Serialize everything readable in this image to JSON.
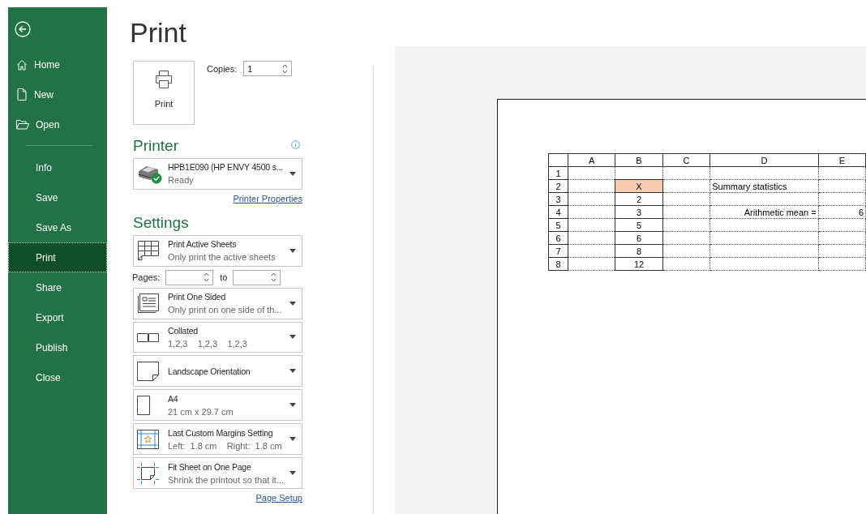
{
  "sidebar": {
    "items": [
      {
        "label": "Home",
        "kind": "home",
        "selected": false
      },
      {
        "label": "New",
        "kind": "new",
        "selected": false
      },
      {
        "label": "Open",
        "kind": "open",
        "selected": false
      },
      {
        "label": "Info",
        "kind": "text",
        "selected": false
      },
      {
        "label": "Save",
        "kind": "text",
        "selected": false
      },
      {
        "label": "Save As",
        "kind": "text",
        "selected": false
      },
      {
        "label": "Print",
        "kind": "text",
        "selected": true
      },
      {
        "label": "Share",
        "kind": "text",
        "selected": false
      },
      {
        "label": "Export",
        "kind": "text",
        "selected": false
      },
      {
        "label": "Publish",
        "kind": "text",
        "selected": false
      },
      {
        "label": "Close",
        "kind": "text",
        "selected": false
      }
    ]
  },
  "title": "Print",
  "print_button": {
    "label": "Print"
  },
  "copies": {
    "label": "Copies:",
    "value": "1"
  },
  "printer": {
    "heading": "Printer",
    "name": "HPB1E090 (HP ENVY 4500 s...",
    "status": "Ready",
    "properties_link": "Printer Properties"
  },
  "settings": {
    "heading": "Settings",
    "options": [
      {
        "kind": "sheets",
        "title": "Print Active Sheets",
        "subtitle": "Only print the active sheets"
      },
      {
        "kind": "pages",
        "label": "Pages:",
        "to_label": "to"
      },
      {
        "kind": "sides",
        "title": "Print One Sided",
        "subtitle": "Only print on one side of th..."
      },
      {
        "kind": "collate",
        "title": "Collated",
        "subtitle": "1,2,3    1,2,3    1,2,3"
      },
      {
        "kind": "orientation",
        "title": "Landscape Orientation"
      },
      {
        "kind": "paper",
        "title": "A4",
        "subtitle": "21 cm x 29.7 cm"
      },
      {
        "kind": "margins",
        "title": "Last Custom Margins Setting",
        "subtitle": "Left:  1.8 cm    Right:  1.8 cm"
      },
      {
        "kind": "scaling",
        "title": "Fit Sheet on One Page",
        "subtitle": "Shrink the printout so that it..."
      }
    ],
    "page_setup_link": "Page Setup"
  },
  "preview": {
    "columns": [
      "A",
      "B",
      "C",
      "D",
      "E"
    ],
    "rows": [
      {
        "label": "1",
        "cells": [
          null,
          null,
          null,
          null,
          null
        ]
      },
      {
        "label": "2",
        "cells": [
          null,
          {
            "text": "X",
            "kind": "data",
            "highlighted": true
          },
          null,
          {
            "text": "Summary statistics",
            "kind": "heading"
          },
          null
        ]
      },
      {
        "label": "3",
        "cells": [
          null,
          {
            "text": "2",
            "kind": "data",
            "highlighted": false
          },
          null,
          null,
          null
        ]
      },
      {
        "label": "4",
        "cells": [
          null,
          {
            "text": "3",
            "kind": "data",
            "highlighted": false
          },
          null,
          {
            "text": "Arithmetic mean =",
            "kind": "label"
          },
          {
            "text": "6",
            "kind": "result"
          }
        ]
      },
      {
        "label": "5",
        "cells": [
          null,
          {
            "text": "5",
            "kind": "data",
            "highlighted": false
          },
          null,
          null,
          null
        ]
      },
      {
        "label": "6",
        "cells": [
          null,
          {
            "text": "6",
            "kind": "data",
            "highlighted": false
          },
          null,
          null,
          null
        ]
      },
      {
        "label": "7",
        "cells": [
          null,
          {
            "text": "8",
            "kind": "data",
            "highlighted": false
          },
          null,
          null,
          null
        ]
      },
      {
        "label": "8",
        "cells": [
          null,
          {
            "text": "12",
            "kind": "data",
            "highlighted": false
          },
          null,
          null,
          null
        ]
      }
    ]
  }
}
